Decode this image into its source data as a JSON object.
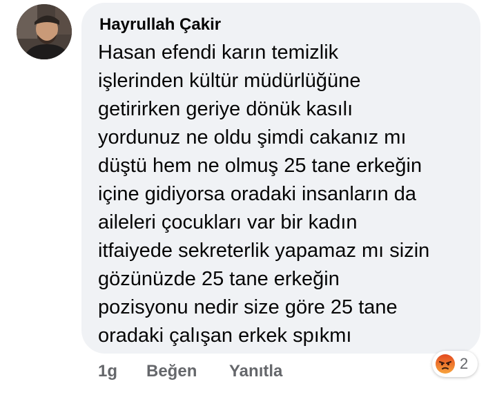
{
  "comment": {
    "author": "Hayrullah Çakir",
    "avatar_icon": "profile-photo",
    "lines": [
      "Hasan efendi karın temizlik",
      "işlerinden kültür müdürlüğüne",
      "getirirken geriye dönük kasılı",
      "yordunuz ne oldu şimdi cakanız mı",
      "düştü hem ne olmuş 25 tane erkeğin",
      "içine gidiyorsa oradaki insanların da",
      "aileleri çocukları var bir kadın",
      "itfaiyede sekreterlik yapamaz mı sizin",
      "gözünüzde 25 tane erkeğin",
      "pozisyonu nedir size göre 25 tane",
      "oradaki çalışan erkek spıkmı"
    ],
    "bubble_color": "#f0f2f5"
  },
  "actions": {
    "time": "1g",
    "like_label": "Beğen",
    "reply_label": "Yanıtla",
    "muted_color": "#65676b"
  },
  "reactions": {
    "icon": "angry-reaction-icon",
    "count": "2",
    "icon_colors": [
      "#f78b3c",
      "#e34a1f"
    ]
  }
}
